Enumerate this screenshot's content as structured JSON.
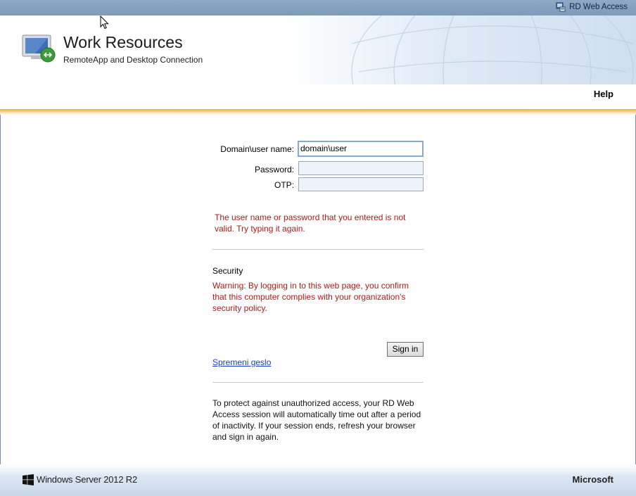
{
  "topbar": {
    "link_label": "RD Web Access",
    "link_icon": "rdwa-icon"
  },
  "header": {
    "title": "Work Resources",
    "subtitle": "RemoteApp and Desktop Connection",
    "logo_icon": "remote-desktop-icon"
  },
  "nav": {
    "help_label": "Help"
  },
  "form": {
    "username_label": "Domain\\user name:",
    "username_value": "domain\\user",
    "password_label": "Password:",
    "password_value": "",
    "otp_label": "OTP:",
    "otp_value": "",
    "error_message": "The user name or password that you entered is not valid. Try typing it again."
  },
  "security": {
    "heading": "Security",
    "warning": "Warning: By logging in to this web page, you confirm that this computer complies with your organization's security policy."
  },
  "signin_label": "Sign in",
  "change_password_link": "Spremeni geslo",
  "timeout_notice": "To protect against unauthorized access, your RD Web Access session will automatically time out after a period of inactivity. If your session ends, refresh your browser and sign in again.",
  "footer": {
    "product": "Windows Server 2012 R2",
    "brand": "Microsoft"
  },
  "colors": {
    "accent_orange": "#f7a740",
    "error_red": "#b01a1a",
    "link_blue": "#1a3ec7",
    "topbar_blue": "#8fa9c6"
  }
}
